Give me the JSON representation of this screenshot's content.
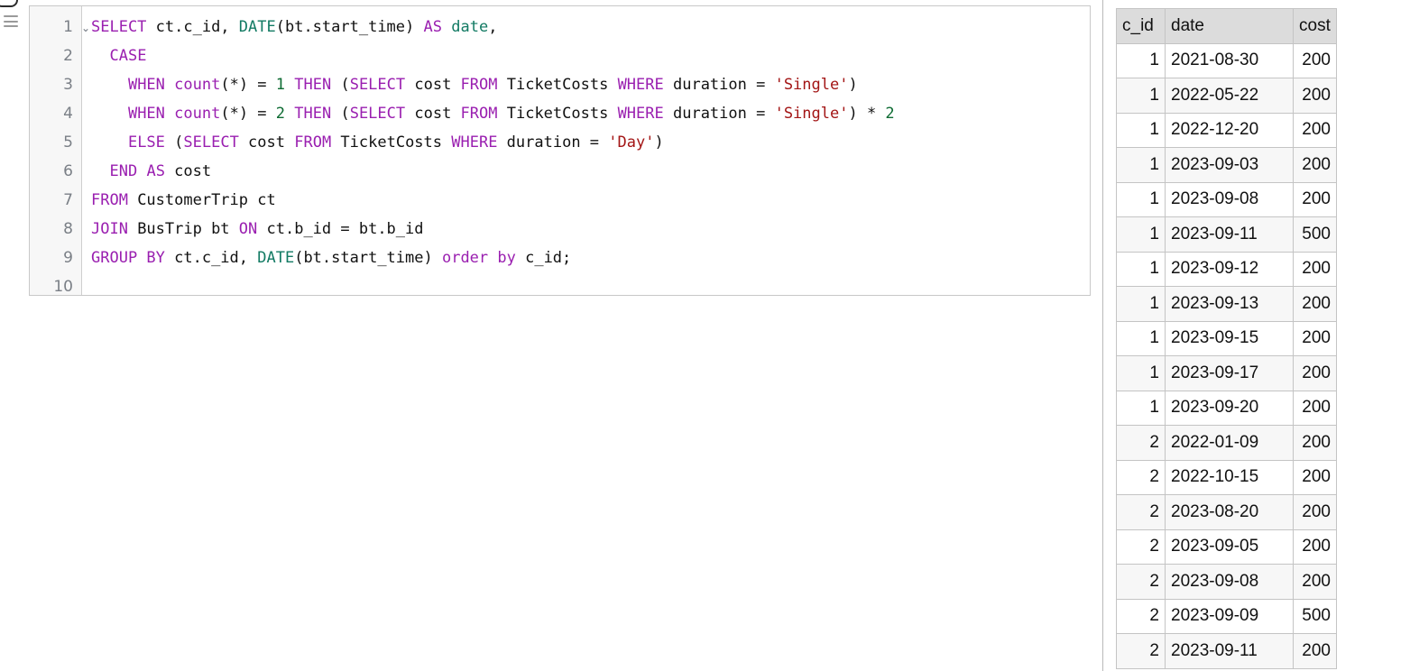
{
  "rail": {
    "hamburger_icon": "hamburger-icon",
    "tab_icon": "panel-tab-icon"
  },
  "editor": {
    "line_numbers": [
      "1",
      "2",
      "3",
      "4",
      "5",
      "6",
      "7",
      "8",
      "9",
      "10"
    ],
    "fold_chevron": "⌄",
    "lines": [
      {
        "number": "1",
        "tokens": [
          {
            "t": "SELECT",
            "c": "kw"
          },
          {
            "t": " ct.c_id, ",
            "c": "plain"
          },
          {
            "t": "DATE",
            "c": "fn"
          },
          {
            "t": "(bt.start_time) ",
            "c": "plain"
          },
          {
            "t": "AS",
            "c": "kw"
          },
          {
            "t": " ",
            "c": "plain"
          },
          {
            "t": "date",
            "c": "fn"
          },
          {
            "t": ",",
            "c": "plain"
          }
        ]
      },
      {
        "number": "2",
        "tokens": [
          {
            "t": "  ",
            "c": "plain"
          },
          {
            "t": "CASE",
            "c": "kw"
          }
        ]
      },
      {
        "number": "3",
        "tokens": [
          {
            "t": "    ",
            "c": "plain"
          },
          {
            "t": "WHEN",
            "c": "kw"
          },
          {
            "t": " ",
            "c": "plain"
          },
          {
            "t": "count",
            "c": "kw"
          },
          {
            "t": "(*) = ",
            "c": "plain"
          },
          {
            "t": "1",
            "c": "num"
          },
          {
            "t": " ",
            "c": "plain"
          },
          {
            "t": "THEN",
            "c": "kw"
          },
          {
            "t": " (",
            "c": "plain"
          },
          {
            "t": "SELECT",
            "c": "kw"
          },
          {
            "t": " cost ",
            "c": "plain"
          },
          {
            "t": "FROM",
            "c": "kw"
          },
          {
            "t": " TicketCosts ",
            "c": "plain"
          },
          {
            "t": "WHERE",
            "c": "kw"
          },
          {
            "t": " duration = ",
            "c": "plain"
          },
          {
            "t": "'Single'",
            "c": "str"
          },
          {
            "t": ")",
            "c": "plain"
          }
        ]
      },
      {
        "number": "4",
        "tokens": [
          {
            "t": "    ",
            "c": "plain"
          },
          {
            "t": "WHEN",
            "c": "kw"
          },
          {
            "t": " ",
            "c": "plain"
          },
          {
            "t": "count",
            "c": "kw"
          },
          {
            "t": "(*) = ",
            "c": "plain"
          },
          {
            "t": "2",
            "c": "num"
          },
          {
            "t": " ",
            "c": "plain"
          },
          {
            "t": "THEN",
            "c": "kw"
          },
          {
            "t": " (",
            "c": "plain"
          },
          {
            "t": "SELECT",
            "c": "kw"
          },
          {
            "t": " cost ",
            "c": "plain"
          },
          {
            "t": "FROM",
            "c": "kw"
          },
          {
            "t": " TicketCosts ",
            "c": "plain"
          },
          {
            "t": "WHERE",
            "c": "kw"
          },
          {
            "t": " duration = ",
            "c": "plain"
          },
          {
            "t": "'Single'",
            "c": "str"
          },
          {
            "t": ") * ",
            "c": "plain"
          },
          {
            "t": "2",
            "c": "num"
          }
        ]
      },
      {
        "number": "5",
        "tokens": [
          {
            "t": "    ",
            "c": "plain"
          },
          {
            "t": "ELSE",
            "c": "kw"
          },
          {
            "t": " (",
            "c": "plain"
          },
          {
            "t": "SELECT",
            "c": "kw"
          },
          {
            "t": " cost ",
            "c": "plain"
          },
          {
            "t": "FROM",
            "c": "kw"
          },
          {
            "t": " TicketCosts ",
            "c": "plain"
          },
          {
            "t": "WHERE",
            "c": "kw"
          },
          {
            "t": " duration = ",
            "c": "plain"
          },
          {
            "t": "'Day'",
            "c": "str"
          },
          {
            "t": ")",
            "c": "plain"
          }
        ]
      },
      {
        "number": "6",
        "tokens": [
          {
            "t": "  ",
            "c": "plain"
          },
          {
            "t": "END",
            "c": "kw"
          },
          {
            "t": " ",
            "c": "plain"
          },
          {
            "t": "AS",
            "c": "kw"
          },
          {
            "t": " cost",
            "c": "plain"
          }
        ]
      },
      {
        "number": "7",
        "tokens": [
          {
            "t": "FROM",
            "c": "kw"
          },
          {
            "t": " CustomerTrip ct",
            "c": "plain"
          }
        ]
      },
      {
        "number": "8",
        "tokens": [
          {
            "t": "JOIN",
            "c": "kw"
          },
          {
            "t": " BusTrip bt ",
            "c": "plain"
          },
          {
            "t": "ON",
            "c": "kw"
          },
          {
            "t": " ct.b_id = bt.b_id",
            "c": "plain"
          }
        ]
      },
      {
        "number": "9",
        "tokens": [
          {
            "t": "GROUP BY",
            "c": "kw"
          },
          {
            "t": " ct.c_id, ",
            "c": "plain"
          },
          {
            "t": "DATE",
            "c": "fn"
          },
          {
            "t": "(bt.start_time) ",
            "c": "plain"
          },
          {
            "t": "order by",
            "c": "kw"
          },
          {
            "t": " c_id;",
            "c": "plain"
          }
        ]
      },
      {
        "number": "10",
        "tokens": []
      }
    ],
    "plain_text": "SELECT ct.c_id, DATE(bt.start_time) AS date,\n  CASE\n    WHEN count(*) = 1 THEN (SELECT cost FROM TicketCosts WHERE duration = 'Single')\n    WHEN count(*) = 2 THEN (SELECT cost FROM TicketCosts WHERE duration = 'Single') * 2\n    ELSE (SELECT cost FROM TicketCosts WHERE duration = 'Day')\n  END AS cost\nFROM CustomerTrip ct\nJOIN BusTrip bt ON ct.b_id = bt.b_id\nGROUP BY ct.c_id, DATE(bt.start_time) order by c_id;"
  },
  "results": {
    "columns": [
      "c_id",
      "date",
      "cost"
    ],
    "rows": [
      [
        "1",
        "2021-08-30",
        "200"
      ],
      [
        "1",
        "2022-05-22",
        "200"
      ],
      [
        "1",
        "2022-12-20",
        "200"
      ],
      [
        "1",
        "2023-09-03",
        "200"
      ],
      [
        "1",
        "2023-09-08",
        "200"
      ],
      [
        "1",
        "2023-09-11",
        "500"
      ],
      [
        "1",
        "2023-09-12",
        "200"
      ],
      [
        "1",
        "2023-09-13",
        "200"
      ],
      [
        "1",
        "2023-09-15",
        "200"
      ],
      [
        "1",
        "2023-09-17",
        "200"
      ],
      [
        "1",
        "2023-09-20",
        "200"
      ],
      [
        "2",
        "2022-01-09",
        "200"
      ],
      [
        "2",
        "2022-10-15",
        "200"
      ],
      [
        "2",
        "2023-08-20",
        "200"
      ],
      [
        "2",
        "2023-09-05",
        "200"
      ],
      [
        "2",
        "2023-09-08",
        "200"
      ],
      [
        "2",
        "2023-09-09",
        "500"
      ],
      [
        "2",
        "2023-09-11",
        "200"
      ]
    ]
  },
  "colors": {
    "keyword": "#9a1fb0",
    "function": "#127a63",
    "string": "#a31515",
    "number": "#0d6b32",
    "plain": "#111111",
    "gutter_bg": "#f7f7f7",
    "table_header_bg": "#dcdcdc",
    "table_alt_row_bg": "#f7f7f7",
    "border": "#c4c4c4"
  }
}
